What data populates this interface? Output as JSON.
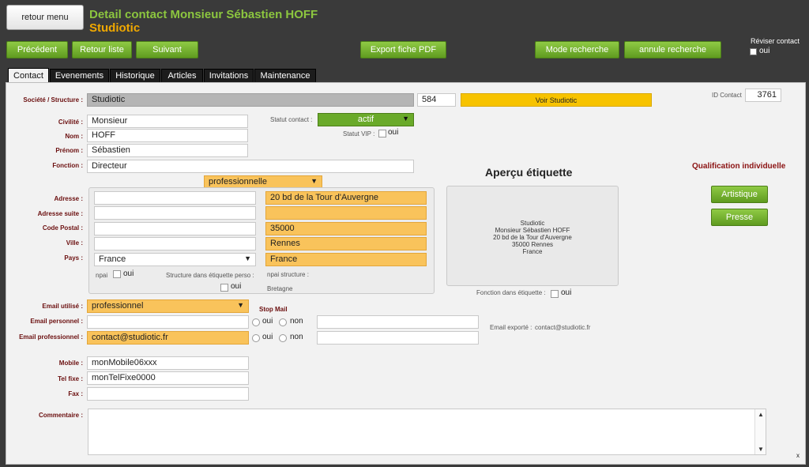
{
  "header": {
    "menu_label": "retour menu",
    "title": "Detail contact Monsieur Sébastien HOFF",
    "subtitle": "Studiotic",
    "reviser_label": "Réviser contact",
    "reviser_oui": "oui"
  },
  "toolbar": {
    "precedent": "Précédent",
    "retour_liste": "Retour liste",
    "suivant": "Suivant",
    "export_pdf": "Export fiche PDF",
    "mode_recherche": "Mode recherche",
    "annule_recherche": "annule recherche"
  },
  "tabs": [
    "Contact",
    "Evenements",
    "Historique",
    "Articles",
    "Invitations",
    "Maintenance"
  ],
  "contact": {
    "societe_label": "Société / Structure :",
    "societe_value": "Studiotic",
    "societe_id": "584",
    "voir_button": "Voir Studiotic",
    "id_contact_label": "ID Contact",
    "id_contact_value": "3761",
    "civilite_label": "Civilité :",
    "civilite_value": "Monsieur",
    "nom_label": "Nom :",
    "nom_value": "HOFF",
    "prenom_label": "Prénom :",
    "prenom_value": "Sébastien",
    "fonction_label": "Fonction :",
    "fonction_value": "Directeur",
    "statut_label": "Statut contact :",
    "statut_value": "actif",
    "vip_label": "Statut VIP :",
    "vip_oui": "oui"
  },
  "address": {
    "type_value": "professionnelle",
    "adresse_label": "Adresse :",
    "adresse_suite_label": "Adresse suite :",
    "code_postal_label": "Code Postal :",
    "ville_label": "Ville :",
    "pays_label": "Pays :",
    "perso_pays": "France",
    "npai_label": "npai",
    "npai_oui": "oui",
    "structure_etiquette_label": "Structure dans étiquette perso :",
    "structure_etiquette_oui": "oui",
    "struct_adresse": "20 bd de la Tour d'Auvergne",
    "struct_adresse_suite": "",
    "struct_code_postal": "35000",
    "struct_ville": "Rennes",
    "struct_pays": "France",
    "npai_structure_label": "npai structure :",
    "region": "Bretagne"
  },
  "preview": {
    "title": "Aperçu étiquette",
    "lines": [
      "Studiotic",
      "Monsieur Sébastien HOFF",
      "20 bd de la Tour d'Auvergne",
      "35000 Rennes",
      "France"
    ],
    "fonction_label": "Fonction dans étiquette :",
    "fonction_oui": "oui"
  },
  "qualification": {
    "title": "Qualification individuelle",
    "artistique": "Artistique",
    "presse": "Presse"
  },
  "email": {
    "utilise_label": "Email utilisé :",
    "utilise_value": "professionnel",
    "stop_mail_label": "Stop Mail",
    "personnel_label": "Email personnel :",
    "personnel_value": "",
    "professionnel_label": "Email professionnel :",
    "professionnel_value": "contact@studiotic.fr",
    "oui": "oui",
    "non": "non",
    "exporte_label": "Email exporté :",
    "exporte_value": "contact@studiotic.fr"
  },
  "phones": {
    "mobile_label": "Mobile :",
    "mobile_value": "monMobile06xxx",
    "telfixe_label": "Tel fixe :",
    "telfixe_value": "monTelFixe0000",
    "fax_label": "Fax :",
    "fax_value": ""
  },
  "commentaire": {
    "label": "Commentaire :",
    "value": ""
  },
  "close_mark": "x"
}
